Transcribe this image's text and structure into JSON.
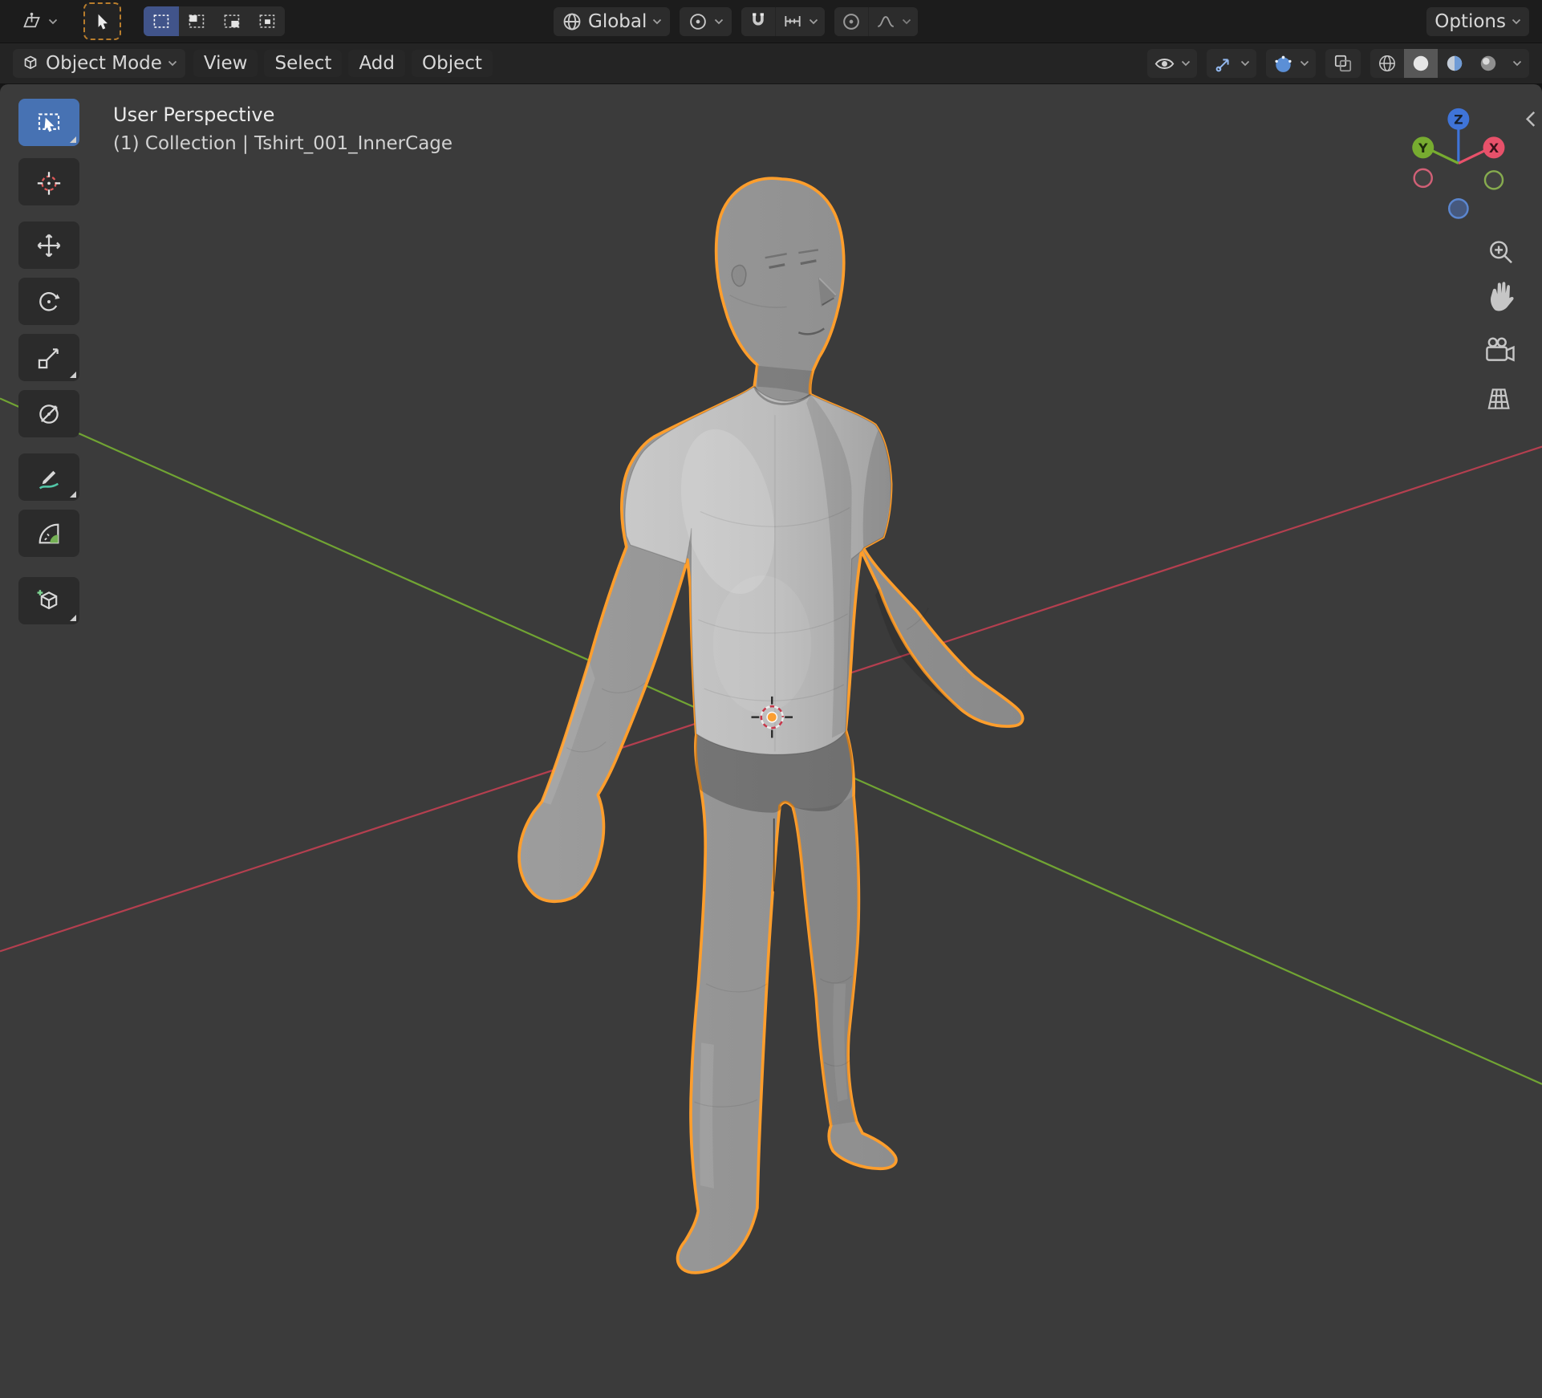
{
  "topbar": {
    "transform_orientation_label": "Global",
    "options_label": "Options",
    "select_modes": [
      "set",
      "extend",
      "subtract",
      "intersect"
    ]
  },
  "viewport_header": {
    "mode_label": "Object Mode",
    "menus": [
      {
        "label": "View"
      },
      {
        "label": "Select"
      },
      {
        "label": "Add"
      },
      {
        "label": "Object"
      }
    ]
  },
  "viewport": {
    "view_label": "User Perspective",
    "collection_label": "(1) Collection | Tshirt_001_InnerCage",
    "gizmo": {
      "x_label": "X",
      "y_label": "Y",
      "z_label": "Z"
    }
  },
  "tools": [
    "select-box",
    "cursor",
    "move",
    "rotate",
    "scale",
    "transform",
    "annotate",
    "measure",
    "add-cube"
  ],
  "colors": {
    "selection_outline": "#ff9e2c",
    "active_tool_blue": "#4772b3",
    "axis_x": "#c24052",
    "axis_y": "#77b033",
    "gizmo_x": "#e8516a",
    "gizmo_y": "#77ac30",
    "gizmo_z": "#3f74d8"
  }
}
